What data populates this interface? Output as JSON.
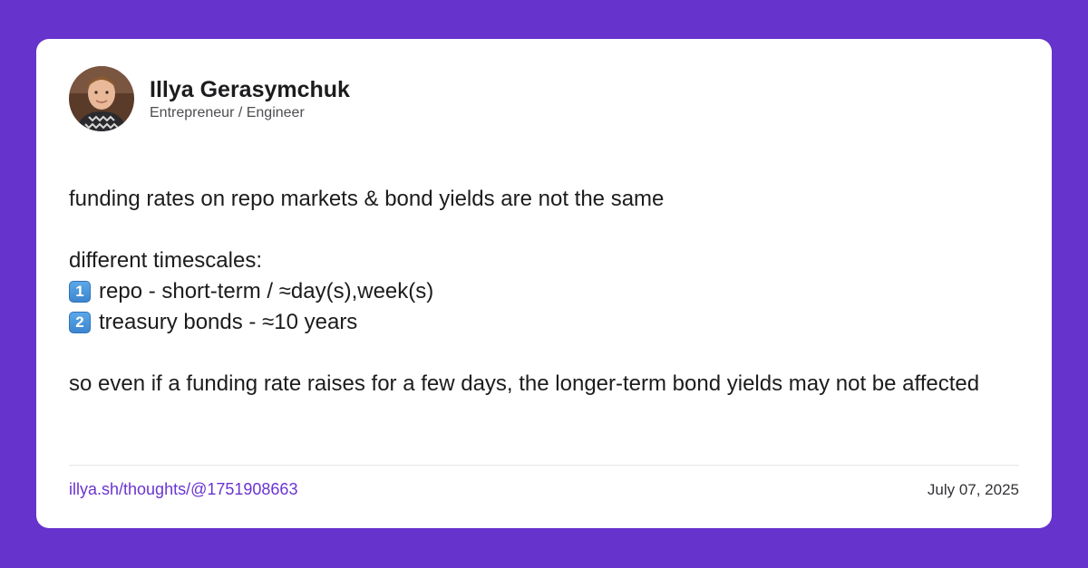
{
  "author": {
    "name": "Illya Gerasymchuk",
    "role": "Entrepreneur / Engineer"
  },
  "post": {
    "line1": "funding rates on repo markets & bond yields are not the same",
    "line2": "different timescales:",
    "item1_marker": "1",
    "item1_text": "repo - short-term / ≈day(s),week(s)",
    "item2_marker": "2",
    "item2_text": "treasury bonds - ≈10 years",
    "line3": "so even if a funding rate raises for a few days, the longer-term bond yields may not be affected"
  },
  "footer": {
    "link": "illya.sh/thoughts/@1751908663",
    "date": "July 07, 2025"
  },
  "colors": {
    "background": "#6633cc",
    "link": "#6a35d0",
    "keycap": "#3d86cf"
  }
}
